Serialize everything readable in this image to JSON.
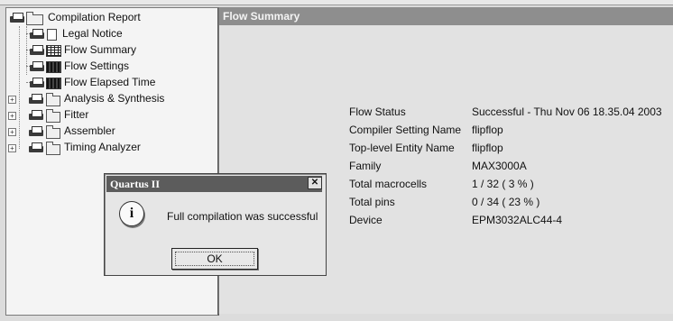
{
  "tree": {
    "root": "Compilation Report",
    "items": [
      {
        "label": "Legal Notice"
      },
      {
        "label": "Flow Summary"
      },
      {
        "label": "Flow Settings"
      },
      {
        "label": "Flow Elapsed Time"
      },
      {
        "label": "Analysis & Synthesis"
      },
      {
        "label": "Fitter"
      },
      {
        "label": "Assembler"
      },
      {
        "label": "Timing Analyzer"
      }
    ]
  },
  "summary": {
    "header": "Flow Summary",
    "rows": [
      {
        "key": "Flow Status",
        "value": "Successful - Thu Nov 06 18.35.04 2003"
      },
      {
        "key": "Compiler Setting Name",
        "value": "flipflop"
      },
      {
        "key": "Top-level Entity Name",
        "value": "flipflop"
      },
      {
        "key": "Family",
        "value": "MAX3000A"
      },
      {
        "key": "Total macrocells",
        "value": "1 / 32 ( 3 % )"
      },
      {
        "key": "Total pins",
        "value": "0 / 34 ( 23 % )"
      },
      {
        "key": "Device",
        "value": "EPM3032ALC44-4"
      }
    ]
  },
  "dialog": {
    "title": "Quartus II",
    "close_glyph": "✕",
    "info_glyph": "i",
    "message": "Full compilation was successful",
    "ok_label": "OK"
  }
}
